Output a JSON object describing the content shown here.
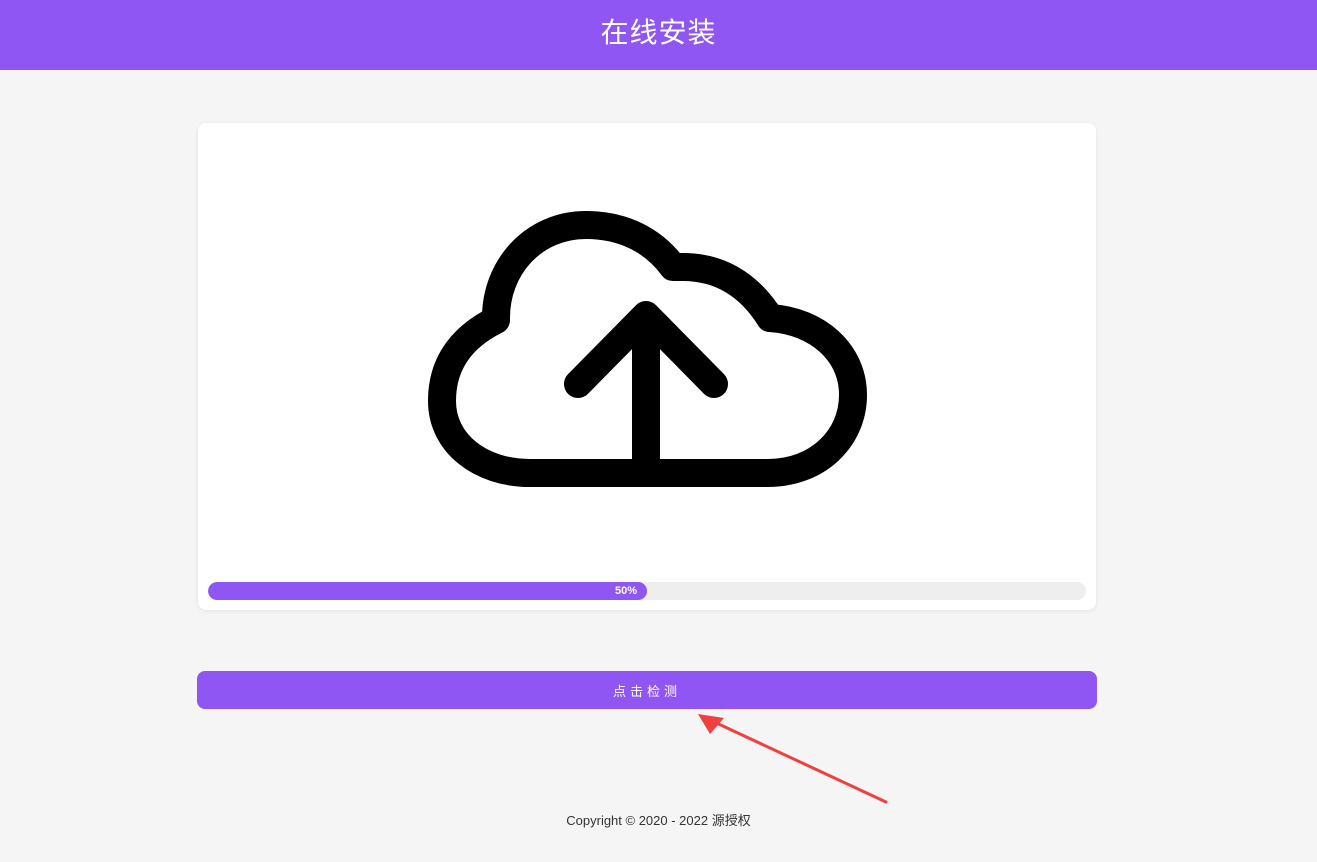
{
  "header": {
    "title": "在线安装"
  },
  "upload": {
    "icon": "cloud-upload-icon",
    "progress_percent": 50,
    "progress_label": "50%"
  },
  "actions": {
    "check_label": "点击检测"
  },
  "annotation": {
    "icon": "red-arrow-icon"
  },
  "footer": {
    "copyright": "Copyright © 2020 - 2022 源授权"
  },
  "colors": {
    "accent": "#9056f3",
    "background": "#f5f5f5",
    "annotation": "#f04040"
  }
}
